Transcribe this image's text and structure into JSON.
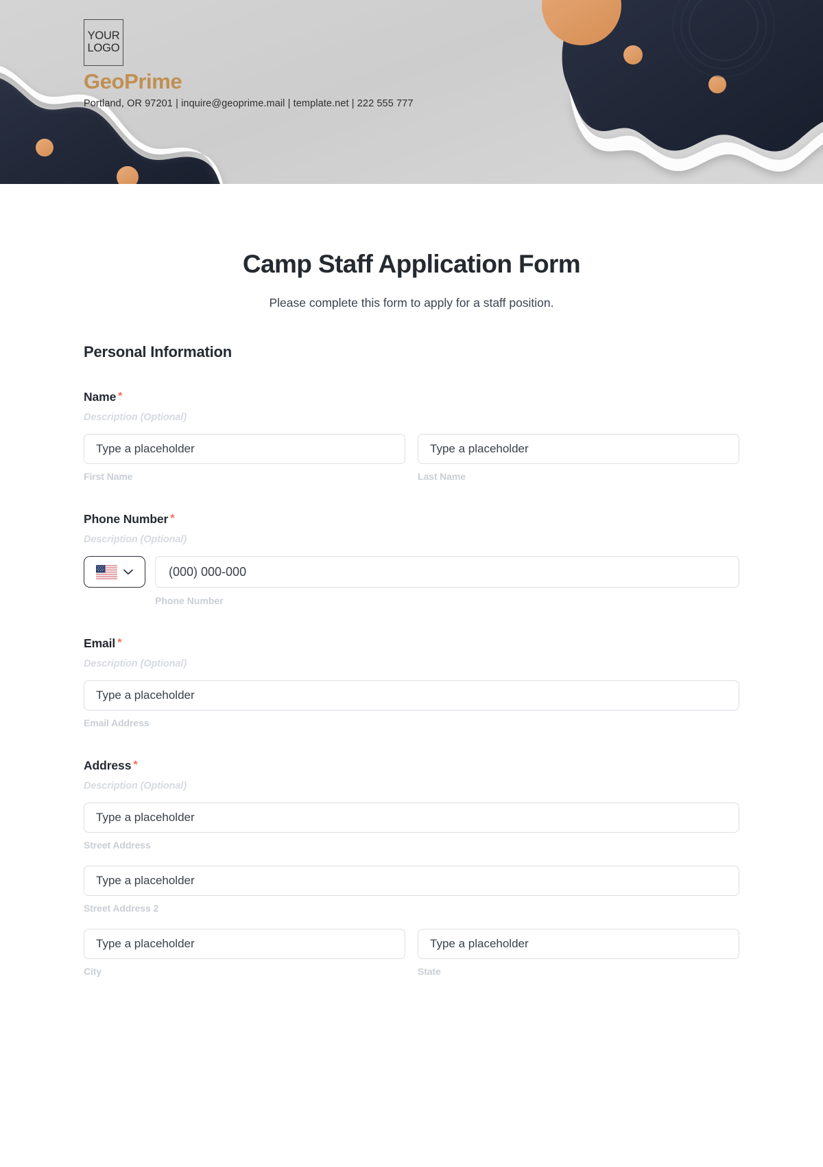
{
  "header": {
    "logo": {
      "line1": "YOUR",
      "line2": "LOGO"
    },
    "brand_name": "GeoPrime",
    "contact_line": "Portland, OR 97201 | inquire@geoprime.mail | template.net | 222 555 777",
    "brand_color": "#c08f52",
    "dark_shape_color": "#232a3b",
    "accent_dot_color": "#e09e67",
    "background_color": "#d4d4d4"
  },
  "form": {
    "title": "Camp Staff Application Form",
    "subtitle": "Please complete this form to apply for a staff position.",
    "section_title": "Personal Information",
    "required_marker": "*",
    "description_placeholder": "Description (Optional)",
    "fields": [
      {
        "label": "Name",
        "required": true,
        "description": "Description (Optional)",
        "inputs": [
          {
            "placeholder": "Type a placeholder",
            "sub_label": "First Name"
          },
          {
            "placeholder": "Type a placeholder",
            "sub_label": "Last Name"
          }
        ]
      },
      {
        "label": "Phone Number",
        "required": true,
        "description": "Description (Optional)",
        "country_code_icon": "us-flag-icon",
        "dropdown_icon": "chevron-down-icon",
        "inputs": [
          {
            "placeholder": "(000) 000-000",
            "sub_label": "Phone Number"
          }
        ]
      },
      {
        "label": "Email",
        "required": true,
        "description": "Description (Optional)",
        "inputs": [
          {
            "placeholder": "Type a placeholder",
            "sub_label": "Email Address"
          }
        ]
      },
      {
        "label": "Address",
        "required": true,
        "description": "Description (Optional)",
        "inputs": [
          {
            "placeholder": "Type a placeholder",
            "sub_label": "Street Address"
          },
          {
            "placeholder": "Type a placeholder",
            "sub_label": "Street Address 2"
          },
          {
            "placeholder": "Type a placeholder",
            "sub_label": "City"
          },
          {
            "placeholder": "Type a placeholder",
            "sub_label": "State"
          }
        ]
      }
    ]
  }
}
